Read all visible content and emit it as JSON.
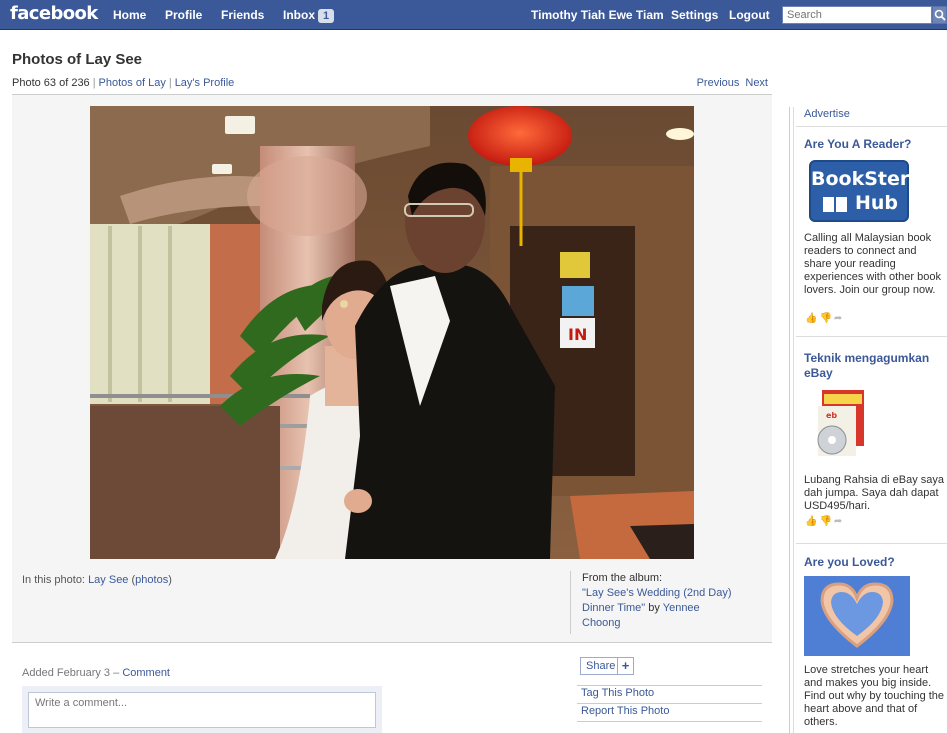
{
  "topbar": {
    "logo": "facebook",
    "nav": {
      "home": "Home",
      "profile": "Profile",
      "friends": "Friends",
      "inbox": "Inbox",
      "inbox_count": "1"
    },
    "user_name": "Timothy Tiah Ewe Tiam",
    "settings": "Settings",
    "logout": "Logout",
    "search_placeholder": "Search"
  },
  "page": {
    "title": "Photos of Lay See",
    "photo_counter": "Photo 63 of 236",
    "photos_of_link": "Photos of Lay",
    "profile_link": "Lay's Profile",
    "previous": "Previous",
    "next": "Next"
  },
  "photo_info": {
    "in_photo_label": "In this photo:",
    "person": "Lay See",
    "photos_link": "photos",
    "album_label": "From the album:",
    "album_title_line1": "\"Lay See's Wedding (2nd Day)",
    "album_title_line2": "Dinner Time\"",
    "by": "by",
    "album_owner_line1": "Yennee",
    "album_owner_line2": "Choong"
  },
  "comments": {
    "added": "Added February 3",
    "dash": "–",
    "comment_link": "Comment",
    "placeholder": "Write a comment..."
  },
  "actions": {
    "share": "Share",
    "share_plus": "+",
    "tag": "Tag This Photo",
    "report": "Report This Photo"
  },
  "ads": {
    "advertise": "Advertise",
    "items": [
      {
        "title": "Are You A Reader?",
        "image_text_1": "BookSter",
        "image_text_2": "Hub",
        "body": "Calling all Malaysian book readers to connect and share your reading experiences with other book lovers. Join our group now."
      },
      {
        "title": "Teknik mengagumkan eBay",
        "body": "Lubang Rahsia di eBay saya dah jumpa. Saya dah dapat USD495/hari."
      },
      {
        "title": "Are you Loved?",
        "body": "Love stretches your heart and makes you big inside. Find out why by touching the heart above and that of others."
      }
    ]
  },
  "colors": {
    "brand_blue": "#3b5998",
    "link_blue": "#3b5998",
    "panel_gray": "#f5f5f5"
  }
}
